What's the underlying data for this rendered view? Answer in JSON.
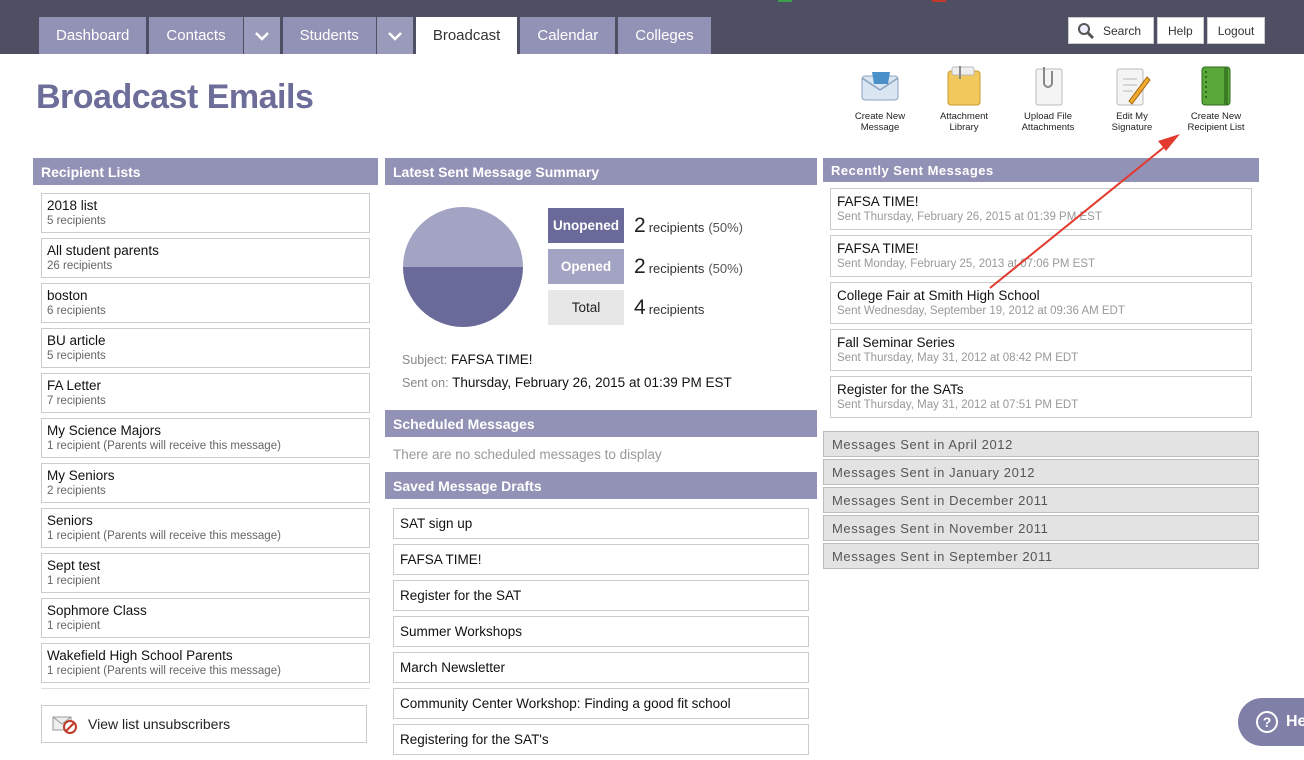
{
  "nav": {
    "tabs": [
      "Dashboard",
      "Contacts",
      "Students",
      "Broadcast",
      "Calendar",
      "Colleges"
    ],
    "active": "Broadcast",
    "links": {
      "search": "Search",
      "help": "Help",
      "logout": "Logout"
    }
  },
  "page_title": "Broadcast Emails",
  "toolbar": [
    {
      "label_1": "Create New",
      "label_2": "Message",
      "icon": "envelope-icon"
    },
    {
      "label_1": "Attachment",
      "label_2": "Library",
      "icon": "folder-icon"
    },
    {
      "label_1": "Upload File",
      "label_2": "Attachments",
      "icon": "paperclip-document-icon"
    },
    {
      "label_1": "Edit My",
      "label_2": "Signature",
      "icon": "pencil-document-icon"
    },
    {
      "label_1": "Create New",
      "label_2": "Recipient List",
      "icon": "notebook-icon"
    }
  ],
  "recipient_lists": {
    "heading": "Recipient Lists",
    "items": [
      {
        "name": "2018 list",
        "count": "5 recipients"
      },
      {
        "name": "All student parents",
        "count": "26 recipients"
      },
      {
        "name": "boston",
        "count": "6 recipients"
      },
      {
        "name": "BU article",
        "count": "5 recipients"
      },
      {
        "name": "FA Letter",
        "count": "7 recipients"
      },
      {
        "name": "My Science Majors",
        "count": "1 recipient (Parents will receive this message)"
      },
      {
        "name": "My Seniors",
        "count": "2 recipients"
      },
      {
        "name": "Seniors",
        "count": "1 recipient (Parents will receive this message)"
      },
      {
        "name": "Sept test",
        "count": "1 recipient"
      },
      {
        "name": "Sophmore Class",
        "count": "1 recipient"
      },
      {
        "name": "Wakefield High School Parents",
        "count": "1 recipient (Parents will receive this message)"
      }
    ],
    "unsubscribers": "View list unsubscribers"
  },
  "summary": {
    "heading": "Latest Sent Message Summary",
    "unopened_label": "Unopened",
    "unopened_num": "2",
    "unopened_unit": "recipients",
    "unopened_pct": "(50%)",
    "opened_label": "Opened",
    "opened_num": "2",
    "opened_unit": "recipients",
    "opened_pct": "(50%)",
    "total_label": "Total",
    "total_num": "4",
    "total_unit": "recipients",
    "opened_fraction": 0.5,
    "subject_label": "Subject:",
    "subject": "FAFSA TIME!",
    "sent_label": "Sent on:",
    "sent": "Thursday, February 26, 2015 at 01:39 PM EST",
    "colors": {
      "unopened": "#6a6a9a",
      "opened": "#a3a3c4",
      "total": "#e7e7e7"
    }
  },
  "scheduled": {
    "heading": "Scheduled Messages",
    "empty": "There are no scheduled messages to display"
  },
  "drafts": {
    "heading": "Saved Message Drafts",
    "items": [
      "SAT sign up",
      "FAFSA TIME!",
      "Register for the SAT",
      "Summer Workshops",
      "March Newsletter",
      "Community Center Workshop: Finding a good fit school",
      "Registering for the SAT's"
    ]
  },
  "recent": {
    "heading": "Recently Sent Messages",
    "items": [
      {
        "title": "FAFSA TIME!",
        "date": "Sent Thursday, February 26, 2015 at 01:39 PM EST"
      },
      {
        "title": "FAFSA TIME!",
        "date": "Sent Monday, February 25, 2013 at 07:06 PM EST"
      },
      {
        "title": "College Fair at Smith High School",
        "date": "Sent Wednesday, September 19, 2012 at 09:36 AM EDT"
      },
      {
        "title": "Fall Seminar Series",
        "date": "Sent Thursday, May 31, 2012 at 08:42 PM EDT"
      },
      {
        "title": "Register for the SATs",
        "date": "Sent Thursday, May 31, 2012 at 07:51 PM EDT"
      }
    ],
    "archives": [
      "Messages Sent in April 2012",
      "Messages Sent in January 2012",
      "Messages Sent in December 2011",
      "Messages Sent in November 2011",
      "Messages Sent in September 2011"
    ]
  },
  "help_button": "He"
}
